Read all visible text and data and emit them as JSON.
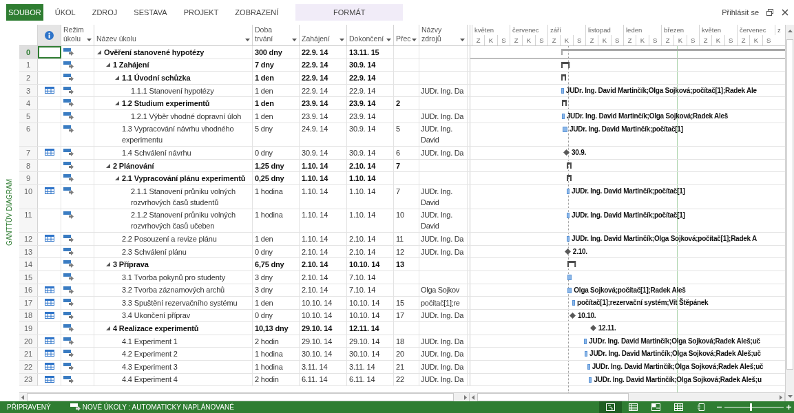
{
  "ribbon_tabs": [
    {
      "label": "SOUBOR",
      "kind": "file",
      "selected": true
    },
    {
      "label": "ÚKOL",
      "kind": "tab",
      "selected": false
    },
    {
      "label": "ZDROJ",
      "kind": "tab",
      "selected": false
    },
    {
      "label": "SESTAVA",
      "kind": "tab",
      "selected": false
    },
    {
      "label": "PROJEKT",
      "kind": "tab",
      "selected": false
    },
    {
      "label": "ZOBRAZENÍ",
      "kind": "tab",
      "selected": false
    },
    {
      "label": "FORMÁT",
      "kind": "contextual",
      "selected": false
    }
  ],
  "account": {
    "sign_in": "Přihlásit se"
  },
  "view_label": "GANTTŮV DIAGRAM",
  "columns": [
    "Režim úkolu",
    "Název úkolu",
    "Doba trvání",
    "Zahájení",
    "Dokončení",
    "Přec",
    "Názvy zdrojů"
  ],
  "timescale": {
    "months": [
      "květen",
      "červenec",
      "září",
      "listopad",
      "leden",
      "březen",
      "květen",
      "červenec",
      "z"
    ],
    "tertials": [
      "Z",
      "K",
      "S",
      "Z",
      "K",
      "S",
      "Z",
      "K",
      "S",
      "Z",
      "K",
      "S",
      "Z",
      "K",
      "S",
      "Z",
      "K",
      "S",
      "Z",
      "K",
      "S",
      "Z",
      "K",
      "S"
    ]
  },
  "tasks": [
    {
      "id": "0",
      "name": "Ověření stanovené hypotézy",
      "duration": "300 dny",
      "start": "22.9. 14",
      "finish": "13.11. 15",
      "selected": true,
      "expanded": true,
      "bar": {
        "kind": "project"
      },
      "children": [
        {
          "id": "1",
          "name": "1 Zahájení",
          "duration": "7 dny",
          "start": "22.9. 14",
          "finish": "30.9. 14",
          "selected": false,
          "expanded": true,
          "bar": {
            "kind": "summary"
          },
          "children": [
            {
              "id": "2",
              "name": "1.1 Úvodní schůzka",
              "duration": "1 den",
              "start": "22.9. 14",
              "finish": "22.9. 14",
              "selected": false,
              "expanded": true,
              "bar": {
                "kind": "summary"
              },
              "children": [
                {
                  "id": "3",
                  "name": "1.1.1 Stanovení hypotézy",
                  "duration": "1 den",
                  "start": "22.9. 14",
                  "finish": "22.9. 14",
                  "resources": "JUDr. Ing. Da",
                  "calendar": true,
                  "selected": false,
                  "bar": {
                    "kind": "task",
                    "label": "JUDr. Ing. David Martinčík;Olga Sojková;počítač[1];Radek Ale"
                  }
                }
              ]
            },
            {
              "id": "4",
              "name": "1.2 Studium experimentů",
              "duration": "1 den",
              "start": "23.9. 14",
              "finish": "23.9. 14",
              "predecessors": "2",
              "selected": false,
              "expanded": true,
              "bar": {
                "kind": "summary"
              },
              "children": [
                {
                  "id": "5",
                  "name": "1.2.1 Výběr vhodné dopravní úloh",
                  "duration": "1 den",
                  "start": "23.9. 14",
                  "finish": "23.9. 14",
                  "resources": "JUDr. Ing. Da",
                  "selected": false,
                  "bar": {
                    "kind": "task",
                    "label": "JUDr. Ing. David Martinčík;Olga Sojková;Radek Aleš"
                  }
                }
              ]
            },
            {
              "id": "6",
              "name": "1.3 Vypracování návrhu vhodného experimentu",
              "duration": "5 dny",
              "start": "24.9. 14",
              "finish": "30.9. 14",
              "predecessors": "5",
              "resources": "JUDr. Ing. David",
              "selected": false,
              "bar": {
                "kind": "task",
                "label": "JUDr. Ing. David Martinčík;počítač[1]"
              }
            },
            {
              "id": "7",
              "name": "1.4 Schválení návrhu",
              "duration": "0 dny",
              "start": "30.9. 14",
              "finish": "30.9. 14",
              "predecessors": "6",
              "resources": "JUDr. Ing. Da",
              "calendar": true,
              "selected": false,
              "bar": {
                "kind": "milestone",
                "label": "30.9."
              }
            }
          ]
        },
        {
          "id": "8",
          "name": "2 Plánování",
          "duration": "1,25 dny",
          "start": "1.10. 14",
          "finish": "2.10. 14",
          "predecessors": "7",
          "selected": false,
          "expanded": true,
          "bar": {
            "kind": "summary"
          },
          "children": [
            {
              "id": "9",
              "name": "2.1 Vypracování plánu experimentů",
              "duration": "0,25 dny",
              "start": "1.10. 14",
              "finish": "1.10. 14",
              "selected": false,
              "expanded": true,
              "bar": {
                "kind": "summary"
              },
              "children": [
                {
                  "id": "10",
                  "name": "2.1.1 Stanovení průniku volných rozvrhových časů studentů",
                  "duration": "1 hodina",
                  "start": "1.10. 14",
                  "finish": "1.10. 14",
                  "predecessors": "7",
                  "resources": "JUDr. Ing. David",
                  "calendar": true,
                  "selected": false,
                  "bar": {
                    "kind": "task",
                    "label": "JUDr. Ing. David Martinčík;počítač[1]"
                  }
                },
                {
                  "id": "11",
                  "name": "2.1.2 Stanovení průniku volných rozvrhových časů učeben",
                  "duration": "1 hodina",
                  "start": "1.10. 14",
                  "finish": "1.10. 14",
                  "predecessors": "10",
                  "resources": "JUDr. Ing. David",
                  "selected": false,
                  "bar": {
                    "kind": "task",
                    "label": "JUDr. Ing. David Martinčík;počítač[1]"
                  }
                }
              ]
            },
            {
              "id": "12",
              "name": "2.2 Posouzení a revize plánu",
              "duration": "1 den",
              "start": "1.10. 14",
              "finish": "2.10. 14",
              "predecessors": "11",
              "resources": "JUDr. Ing. Da",
              "calendar": true,
              "selected": false,
              "bar": {
                "kind": "task",
                "label": "JUDr. Ing. David Martinčík;Olga Sojková;počítač[1];Radek A"
              }
            },
            {
              "id": "13",
              "name": "2.3 Schválení plánu",
              "duration": "0 dny",
              "start": "2.10. 14",
              "finish": "2.10. 14",
              "predecessors": "12",
              "resources": "JUDr. Ing. Da",
              "selected": false,
              "bar": {
                "kind": "milestone",
                "label": "2.10."
              }
            }
          ]
        },
        {
          "id": "14",
          "name": "3 Příprava",
          "duration": "6,75 dny",
          "start": "2.10. 14",
          "finish": "10.10. 14",
          "predecessors": "13",
          "selected": false,
          "expanded": true,
          "bar": {
            "kind": "summary"
          },
          "children": [
            {
              "id": "15",
              "name": "3.1 Tvorba pokynů pro studenty",
              "duration": "3 dny",
              "start": "2.10. 14",
              "finish": "7.10. 14",
              "selected": false,
              "bar": {
                "kind": "task"
              }
            },
            {
              "id": "16",
              "name": "3.2 Tvorba záznamových archů",
              "duration": "3 dny",
              "start": "2.10. 14",
              "finish": "7.10. 14",
              "resources": "Olga Sojkov",
              "calendar": true,
              "selected": false,
              "bar": {
                "kind": "task",
                "label": "Olga Sojková;počítač[1];Radek Aleš"
              }
            },
            {
              "id": "17",
              "name": "3.3 Spuštění rezervačního systému",
              "duration": "1 den",
              "start": "10.10. 14",
              "finish": "10.10. 14",
              "predecessors": "15",
              "resources": "počítač[1];re",
              "calendar": true,
              "selected": false,
              "bar": {
                "kind": "task",
                "label": "počítač[1];rezervační systém;Vít Štěpánek"
              }
            },
            {
              "id": "18",
              "name": "3.4 Ukončení příprav",
              "duration": "0 dny",
              "start": "10.10. 14",
              "finish": "10.10. 14",
              "predecessors": "17",
              "resources": "JUDr. Ing. Da",
              "calendar": true,
              "selected": false,
              "bar": {
                "kind": "milestone",
                "label": "10.10."
              }
            }
          ]
        },
        {
          "id": "19",
          "name": "4 Realizace experimentů",
          "duration": "10,13 dny",
          "start": "29.10. 14",
          "finish": "12.11. 14",
          "selected": false,
          "expanded": true,
          "bar": {
            "kind": "milestone",
            "label": "12.11."
          },
          "children": [
            {
              "id": "20",
              "name": "4.1 Experiment 1",
              "duration": "2 hodin",
              "start": "29.10. 14",
              "finish": "29.10. 14",
              "predecessors": "18",
              "resources": "JUDr. Ing. Da",
              "calendar": true,
              "selected": false,
              "bar": {
                "kind": "task",
                "label": "JUDr. Ing. David Martinčík;Olga Sojková;Radek Aleš;uč"
              }
            },
            {
              "id": "21",
              "name": "4.2 Experiment 2",
              "duration": "1 hodina",
              "start": "30.10. 14",
              "finish": "30.10. 14",
              "predecessors": "20",
              "resources": "JUDr. Ing. Da",
              "calendar": true,
              "selected": false,
              "bar": {
                "kind": "task",
                "label": "JUDr. Ing. David Martinčík;Olga Sojková;Radek Aleš;uč"
              }
            },
            {
              "id": "22",
              "name": "4.3 Experiment 3",
              "duration": "1 hodina",
              "start": "3.11. 14",
              "finish": "3.11. 14",
              "predecessors": "21",
              "resources": "JUDr. Ing. Da",
              "calendar": true,
              "selected": false,
              "bar": {
                "kind": "task",
                "label": "JUDr. Ing. David Martinčík;Olga Sojková;Radek Aleš;uč"
              }
            },
            {
              "id": "23",
              "name": "4.4 Experiment 4",
              "duration": "2 hodin",
              "start": "6.11. 14",
              "finish": "6.11. 14",
              "predecessors": "22",
              "resources": "JUDr. Ing. Da",
              "calendar": true,
              "selected": false,
              "bar": {
                "kind": "task",
                "label": "JUDr. Ing. David Martinčík;Olga Sojková;Radek Aleš;u"
              }
            }
          ]
        }
      ]
    }
  ],
  "status_bar": {
    "state": "PŘIPRAVENÝ",
    "mode": "NOVÉ ÚKOLY : AUTOMATICKY NAPLÁNOVANÉ",
    "views": [
      {
        "kind": "gantt",
        "selected": true
      },
      {
        "kind": "sheet",
        "selected": false
      },
      {
        "kind": "usage",
        "selected": false
      },
      {
        "kind": "grid",
        "selected": false
      },
      {
        "kind": "form",
        "selected": false
      }
    ],
    "zoom": {
      "level": 0.45
    }
  }
}
